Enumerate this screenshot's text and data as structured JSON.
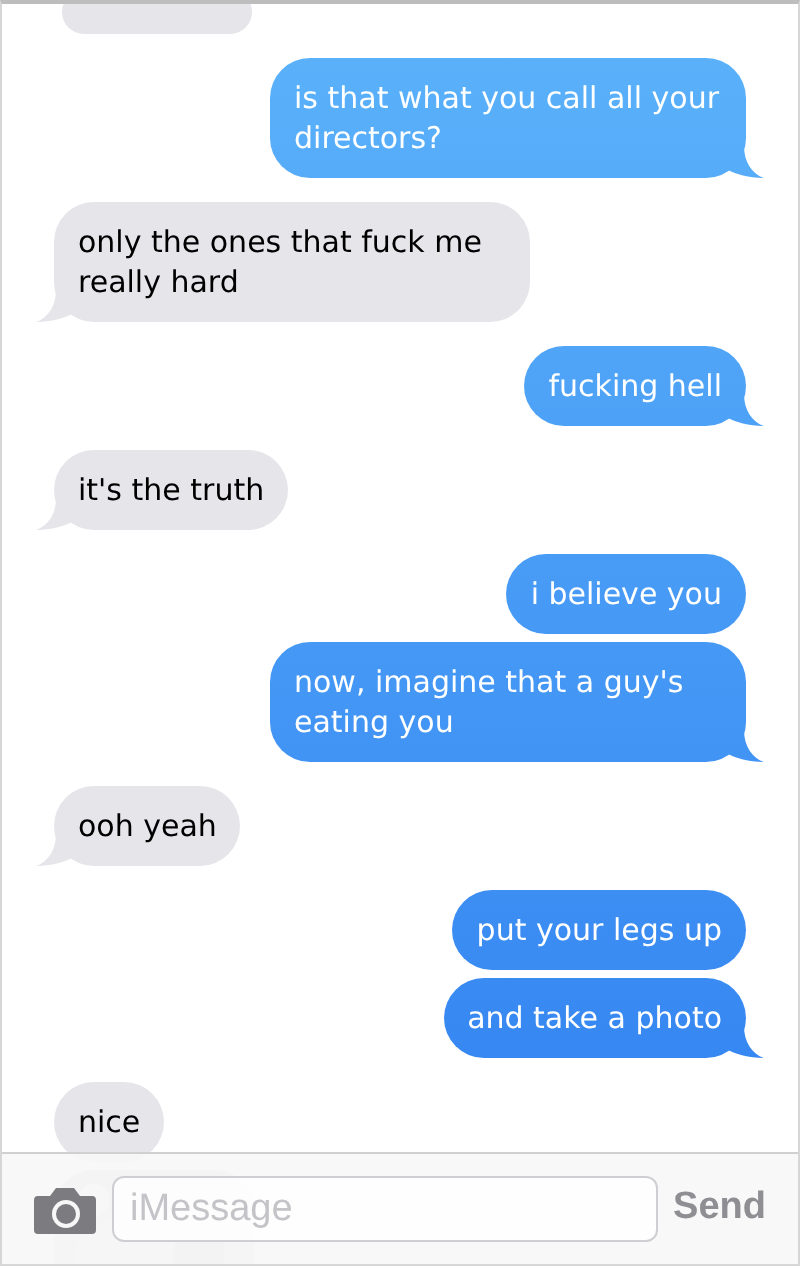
{
  "messages": [
    {
      "outgoing": false,
      "kind": "partial"
    },
    {
      "outgoing": true,
      "kind": "text",
      "text": "is that what you call all your directors?",
      "tail": true
    },
    {
      "outgoing": false,
      "kind": "text",
      "text": "only the ones that fuck me really hard",
      "tail": true
    },
    {
      "outgoing": true,
      "kind": "text",
      "text": "fucking hell",
      "tail": true
    },
    {
      "outgoing": false,
      "kind": "text",
      "text": "it's the truth",
      "tail": true
    },
    {
      "outgoing": true,
      "kind": "text",
      "text": "i believe you",
      "tail": false
    },
    {
      "outgoing": true,
      "kind": "text",
      "text": "now, imagine that a guy's eating you",
      "tail": true
    },
    {
      "outgoing": false,
      "kind": "text",
      "text": "ooh yeah",
      "tail": true
    },
    {
      "outgoing": true,
      "kind": "text",
      "text": "put your legs up",
      "tail": false
    },
    {
      "outgoing": true,
      "kind": "text",
      "text": "and take a photo",
      "tail": true
    },
    {
      "outgoing": false,
      "kind": "text",
      "text": "nice",
      "tail": false
    },
    {
      "outgoing": false,
      "kind": "picture"
    }
  ],
  "composer": {
    "placeholder": "iMessage",
    "send": "Send"
  }
}
